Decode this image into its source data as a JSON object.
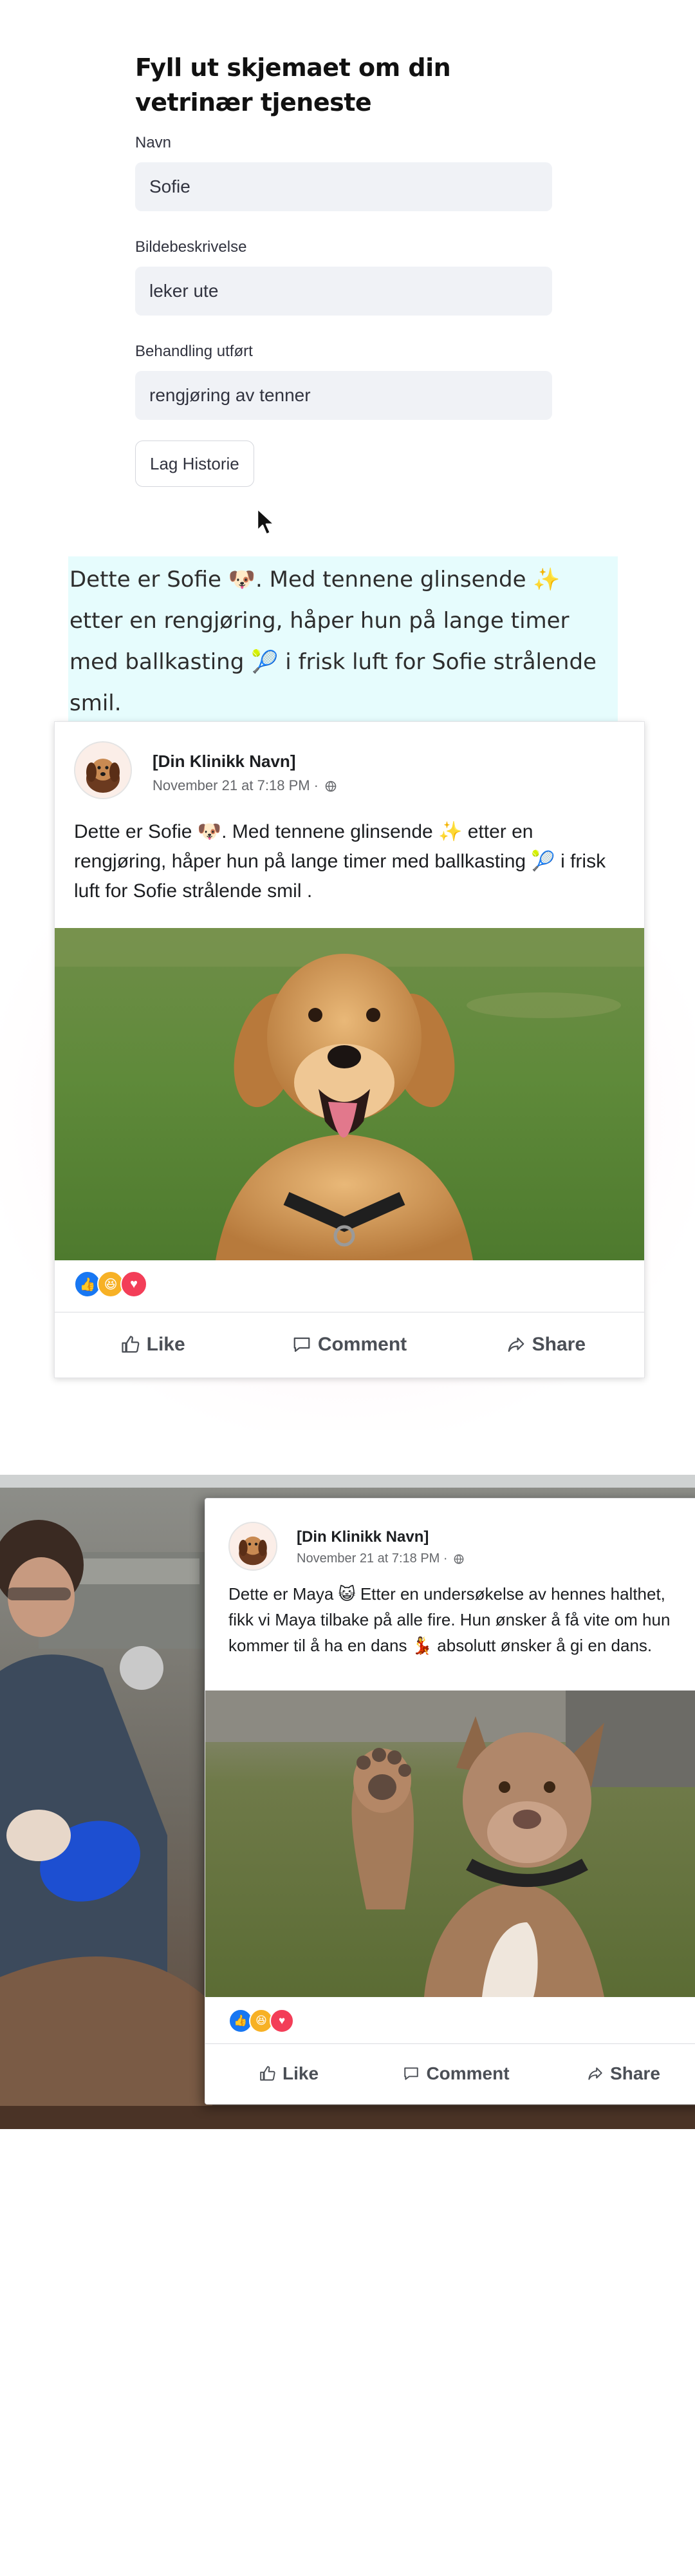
{
  "form": {
    "title": "Fyll ut skjemaet om din vetrinær tjeneste",
    "fields": [
      {
        "label": "Navn",
        "value": "Sofie"
      },
      {
        "label": "Bildebeskrivelse",
        "value": "leker ute"
      },
      {
        "label": "Behandling utført",
        "value": "rengjøring av tenner"
      }
    ],
    "submit_label": "Lag Historie"
  },
  "story": {
    "text": "Dette er Sofie 🐶. Med tennene glinsende ✨ etter en rengjøring, håper hun på lange timer med ballkasting 🎾 i frisk luft for Sofie strålende smil."
  },
  "post1": {
    "clinic_name": "[Din Klinikk Navn]",
    "meta": "November 21 at 7:18 PM ·",
    "text": "Dette er Sofie 🐶. Med tennene glinsende ✨ etter en rengjøring, håper hun på lange timer med ballkasting 🎾 i frisk luft for Sofie strålende smil .",
    "actions": {
      "like": "Like",
      "comment": "Comment",
      "share": "Share"
    }
  },
  "post2": {
    "clinic_name": "[Din Klinikk Navn]",
    "meta": "November 21 at 7:18 PM ·",
    "text": "Dette er Maya 😺 Etter en undersøkelse av hennes halthet, fikk vi Maya tilbake på alle fire. Hun ønsker å få vite om hun kommer til å ha en dans 💃 absolutt ønsker å gi en dans.",
    "actions": {
      "like": "Like",
      "comment": "Comment",
      "share": "Share"
    }
  },
  "reactions": [
    {
      "icon": "like-reaction-icon",
      "color": "#1877f2"
    },
    {
      "icon": "haha-reaction-icon",
      "color": "#f7b125"
    },
    {
      "icon": "love-reaction-icon",
      "color": "#f33e58"
    }
  ],
  "colors": {
    "input_bg": "#f0f2f6",
    "story_highlight": "#e6fcfd",
    "fb_text": "#1c1e21",
    "fb_meta": "#65676b"
  }
}
